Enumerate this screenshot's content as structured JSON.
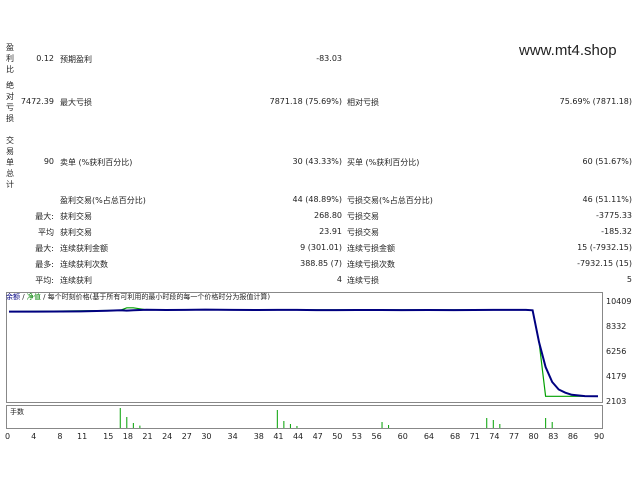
{
  "watermark": "www.mt4.shop",
  "left_labels": {
    "profit_ratio": "盈利比",
    "abs_drawdown": "绝对亏损",
    "total_trades": "交易单总计"
  },
  "rows": {
    "profit_ratio": {
      "value": "0.12",
      "label": "预期盈利",
      "col2_value": "-83.03"
    },
    "drawdown": {
      "value": "7472.39",
      "label": "最大亏损",
      "col2_value": "7871.18 (75.69%)",
      "col3_label": "相对亏损",
      "col3_value": "75.69% (7871.18)"
    },
    "trades": {
      "value": "90",
      "label": "卖单 (%获利百分比)",
      "col2_value": "30 (43.33%)",
      "col3_label": "买单 (%获利百分比)",
      "col3_value": "60 (51.67%)"
    },
    "profit_trades": {
      "label": "盈利交易(%占总百分比)",
      "col2_value": "44 (48.89%)",
      "col3_label": "亏损交易(%占总百分比)",
      "col3_value": "46 (51.11%)"
    },
    "largest": {
      "prefix": "最大:",
      "label": "获利交易",
      "col2_value": "268.80",
      "col3_label": "亏损交易",
      "col3_value": "-3775.33"
    },
    "average": {
      "prefix": "平均",
      "label": "获利交易",
      "col2_value": "23.91",
      "col3_label": "亏损交易",
      "col3_value": "-185.32"
    },
    "max_consec": {
      "prefix": "最大:",
      "label": "连续获利金额",
      "col2_value": "9 (301.01)",
      "col3_label": "连续亏损金额",
      "col3_value": "15 (-7932.15)"
    },
    "max_consec2": {
      "prefix": "最多:",
      "label": "连续获利次数",
      "col2_value": "388.85 (7)",
      "col3_label": "连续亏损次数",
      "col3_value": "-7932.15 (15)"
    },
    "avg_consec": {
      "prefix": "平均:",
      "label": "连续获利",
      "col2_value": "4",
      "col3_label": "连续亏损",
      "col3_value": "5"
    }
  },
  "chart_header": {
    "balance": "余额",
    "sep1": "/",
    "equity": "净值",
    "sep2": "/",
    "note": "每个时刻价格(基于所有可利用的最小时段的每一个价格时分为报值计算)"
  },
  "volume_label": "手数",
  "chart_data": {
    "type": "line",
    "y_ticks": [
      "10409",
      "8332",
      "6256",
      "4179",
      "2103"
    ],
    "x_ticks": [
      "0",
      "4",
      "8",
      "11",
      "15",
      "18",
      "21",
      "24",
      "27",
      "30",
      "34",
      "38",
      "41",
      "44",
      "47",
      "50",
      "53",
      "56",
      "60",
      "64",
      "68",
      "71",
      "74",
      "77",
      "80",
      "83",
      "86",
      "90"
    ],
    "ylim": [
      2103,
      10800
    ],
    "xlim": [
      0,
      90
    ],
    "series": [
      {
        "color": "#000080",
        "x": [
          0,
          4,
          8,
          11,
          15,
          17,
          18,
          19,
          21,
          24,
          27,
          30,
          34,
          38,
          41,
          44,
          47,
          50,
          53,
          56,
          60,
          64,
          68,
          71,
          74,
          77,
          79,
          80,
          81,
          82,
          83,
          84,
          85,
          86,
          88,
          90
        ],
        "values": [
          10180,
          10180,
          10190,
          10200,
          10260,
          10300,
          10280,
          10300,
          10350,
          10330,
          10340,
          10370,
          10340,
          10330,
          10340,
          10340,
          10320,
          10320,
          10330,
          10330,
          10320,
          10330,
          10320,
          10330,
          10340,
          10340,
          10340,
          10300,
          7300,
          5000,
          3600,
          2900,
          2600,
          2400,
          2280,
          2260
        ]
      },
      {
        "color": "#00a000",
        "x": [
          0,
          17,
          18,
          19,
          21,
          79,
          80,
          81,
          82,
          90
        ],
        "values": [
          10180,
          10300,
          10540,
          10540,
          10350,
          10340,
          10300,
          7300,
          2263,
          2263
        ]
      }
    ]
  },
  "volume_data": {
    "x": [
      17,
      18,
      19,
      20,
      41,
      42,
      43,
      44,
      57,
      58,
      73,
      74,
      75,
      82,
      83
    ],
    "values": [
      1.0,
      0.55,
      0.25,
      0.12,
      0.9,
      0.35,
      0.2,
      0.1,
      0.3,
      0.15,
      0.5,
      0.4,
      0.2,
      0.5,
      0.3
    ]
  }
}
